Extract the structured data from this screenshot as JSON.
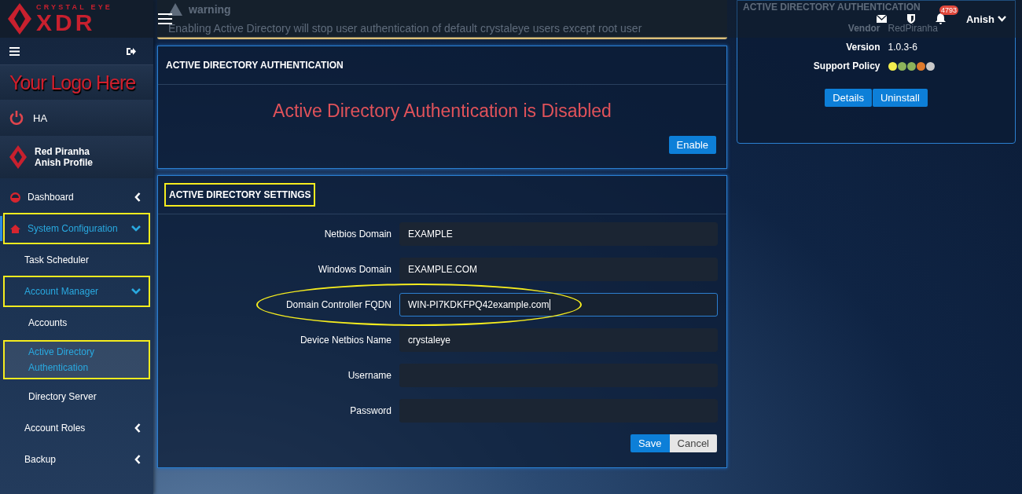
{
  "header": {
    "brand_small": "CRYSTAL EYE",
    "brand_large": "XDR",
    "notification_count": "4793",
    "user": "Anish"
  },
  "sidebar": {
    "logo_text": "Your Logo Here",
    "ha_label": "HA",
    "profile": {
      "name": "Red Piranha",
      "subtitle": "Anish Profile"
    },
    "items": [
      {
        "label": "Dashboard",
        "expanded": false,
        "selected": false,
        "highlighted": false
      },
      {
        "label": "System Configuration",
        "expanded": true,
        "selected": false,
        "highlighted": true,
        "children": [
          {
            "label": "Task Scheduler",
            "selected": false,
            "highlighted": false
          },
          {
            "label": "Account Manager",
            "expanded": true,
            "selected": false,
            "highlighted": true,
            "children": [
              {
                "label": "Accounts",
                "selected": false,
                "highlighted": false
              },
              {
                "label": "Active Directory Authentication",
                "selected": true,
                "highlighted": true
              },
              {
                "label": "Directory Server",
                "selected": false,
                "highlighted": false
              }
            ]
          },
          {
            "label": "Account Roles",
            "expanded": false,
            "selected": false,
            "highlighted": false
          },
          {
            "label": "Backup",
            "expanded": false,
            "selected": false,
            "highlighted": false
          }
        ]
      }
    ]
  },
  "warning": {
    "title": "warning",
    "message": "Enabling Active Directory will stop user authentication of default crystaleye users except root user"
  },
  "auth_panel": {
    "title": "ACTIVE DIRECTORY AUTHENTICATION",
    "status": "Active Directory Authentication is Disabled",
    "button": "Enable"
  },
  "settings_panel": {
    "title": "ACTIVE DIRECTORY SETTINGS",
    "highlighted": true,
    "fields": [
      {
        "label": "Netbios Domain",
        "value": "EXAMPLE",
        "focused": false,
        "highlighted": false
      },
      {
        "label": "Windows Domain",
        "value": "EXAMPLE.COM",
        "focused": false,
        "highlighted": false
      },
      {
        "label": "Domain Controller FQDN",
        "value": "WIN-PI7KDKFPQ42example.com",
        "focused": true,
        "highlighted": true
      },
      {
        "label": "Device Netbios Name",
        "value": "crystaleye",
        "focused": false,
        "highlighted": false
      },
      {
        "label": "Username",
        "focused": false,
        "highlighted": false
      },
      {
        "label": "Password",
        "focused": false,
        "highlighted": false
      }
    ],
    "buttons": [
      "Save",
      "Cancel"
    ]
  },
  "app_card": {
    "title": "ACTIVE DIRECTORY AUTHENTICATION",
    "vendor_label": "Vendor",
    "vendor": "RedPiranha",
    "version_label": "Version",
    "version": "1.0.3-6",
    "support_label": "Support Policy",
    "support_dots": [
      {
        "color": "#f2ee4e"
      },
      {
        "color": "#8db35b"
      },
      {
        "color": "#8db35b"
      },
      {
        "color": "#de7a2c"
      },
      {
        "color": "#c9c9c9"
      }
    ],
    "buttons": [
      "Details",
      "Uninstall"
    ]
  }
}
